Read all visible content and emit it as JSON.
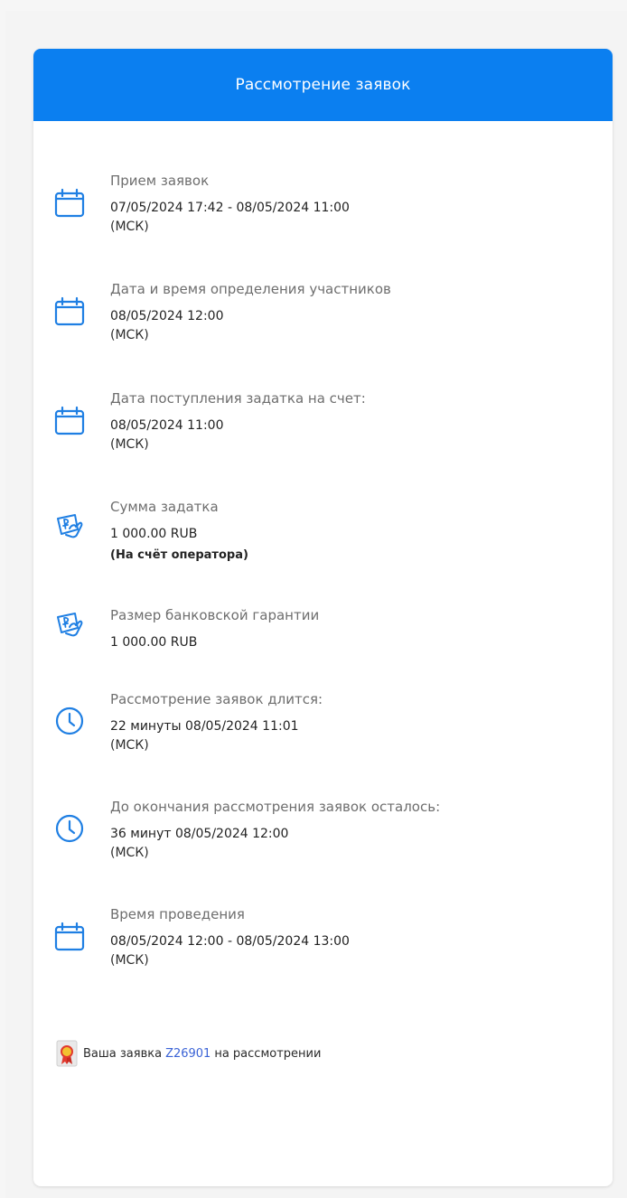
{
  "header": {
    "title": "Рассмотрение заявок"
  },
  "items": [
    {
      "icon": "calendar-icon",
      "label": "Прием заявок",
      "value": "07/05/2024 17:42  - 08/05/2024 11:00",
      "tz": "(МСК)"
    },
    {
      "icon": "calendar-icon",
      "label": "Дата и время определения участников",
      "value": "08/05/2024 12:00",
      "tz": "(МСК)"
    },
    {
      "icon": "calendar-icon",
      "label": "Дата поступления задатка на счет:",
      "value": "08/05/2024 11:00",
      "tz": "(МСК)"
    },
    {
      "icon": "money-hand-icon",
      "label": "Сумма задатка",
      "value": "1 000.00 RUB",
      "note": "(На счёт оператора)"
    },
    {
      "icon": "money-hand-icon",
      "label": "Размер банковской гарантии",
      "value": "1 000.00 RUB"
    },
    {
      "icon": "clock-icon",
      "label": "Рассмотрение заявок длится:",
      "value": "22 минуты 08/05/2024 11:01",
      "tz": "(МСК)"
    },
    {
      "icon": "clock-icon",
      "label": "До окончания рассмотрения заявок осталось:",
      "value": "36 минут 08/05/2024 12:00",
      "tz": "(МСК)"
    },
    {
      "icon": "calendar-icon",
      "label": "Время проведения",
      "value": "08/05/2024 12:00 - 08/05/2024 13:00",
      "tz": "(МСК)"
    }
  ],
  "status": {
    "icon": "certificate-seal-icon",
    "prefix": "Ваша заявка",
    "link": "Z26901",
    "suffix": "на рассмотрении"
  },
  "colors": {
    "accent": "#0b7ff0",
    "link": "#3b63d6",
    "icon": "#1f7fe3"
  }
}
